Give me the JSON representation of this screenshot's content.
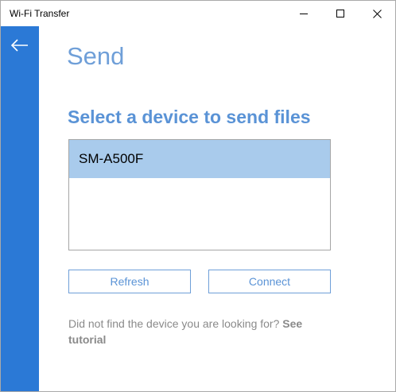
{
  "window": {
    "title": "Wi-Fi Transfer",
    "controls": [
      "minimize-icon",
      "maximize-icon",
      "close-icon"
    ]
  },
  "sidebar": {
    "back_icon": "arrow-left-icon",
    "accent_color": "#2b79d6"
  },
  "page": {
    "title": "Send",
    "subtitle": "Select a device to send files"
  },
  "devices": {
    "items": [
      {
        "label": "SM-A500F",
        "selected": true
      }
    ]
  },
  "actions": {
    "refresh_label": "Refresh",
    "connect_label": "Connect"
  },
  "help": {
    "text": "Did not find the device you are looking for?",
    "link_label": "See tutorial"
  },
  "colors": {
    "title": "#6f9fd8",
    "selection": "#a9cbec",
    "button_border": "#6f9fd8",
    "help_text": "#8a8a8a"
  }
}
